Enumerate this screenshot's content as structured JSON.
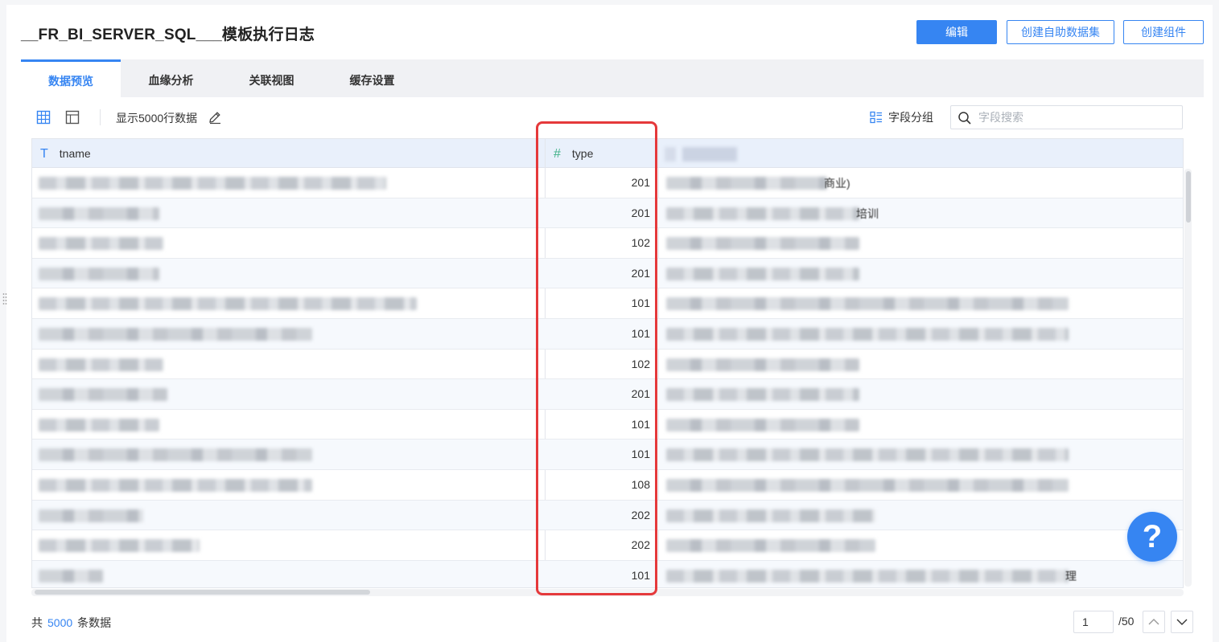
{
  "header": {
    "title": "__FR_BI_SERVER_SQL___模板执行日志",
    "edit_label": "编辑",
    "create_dataset_label": "创建自助数据集",
    "create_component_label": "创建组件"
  },
  "tabs": [
    {
      "label": "数据预览",
      "active": true
    },
    {
      "label": "血缘分析",
      "active": false
    },
    {
      "label": "关联视图",
      "active": false
    },
    {
      "label": "缓存设置",
      "active": false
    }
  ],
  "toolbar": {
    "row_count_label": "显示5000行数据",
    "field_group_label": "字段分组",
    "search_placeholder": "字段搜索"
  },
  "table": {
    "columns": [
      {
        "name": "tname",
        "type_icon": "T"
      },
      {
        "name": "type",
        "type_icon": "#"
      }
    ],
    "rows": [
      {
        "type": "201",
        "tail": "商业)"
      },
      {
        "type": "201",
        "tail": "培训"
      },
      {
        "type": "102",
        "tail": ""
      },
      {
        "type": "201",
        "tail": ""
      },
      {
        "type": "101",
        "tail": ""
      },
      {
        "type": "101",
        "tail": ""
      },
      {
        "type": "102",
        "tail": ""
      },
      {
        "type": "201",
        "tail": ""
      },
      {
        "type": "101",
        "tail": ""
      },
      {
        "type": "101",
        "tail": ""
      },
      {
        "type": "108",
        "tail": ""
      },
      {
        "type": "202",
        "tail": ""
      },
      {
        "type": "202",
        "tail": ""
      },
      {
        "type": "101",
        "tail": "理"
      }
    ]
  },
  "footer": {
    "total_prefix": "共",
    "total_count": "5000",
    "total_suffix": "条数据",
    "current_page": "1",
    "page_total": "/50"
  },
  "help": {
    "label": "?"
  },
  "colors": {
    "accent": "#3685f2",
    "highlight": "#e5393b",
    "header_bg": "#e9f0fb"
  }
}
